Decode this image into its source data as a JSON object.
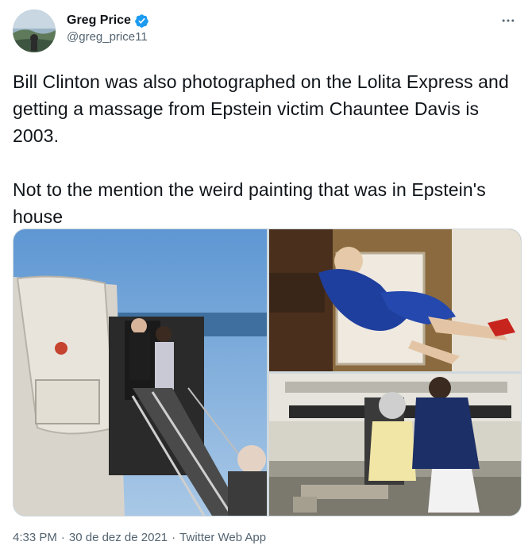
{
  "author": {
    "display_name": "Greg Price",
    "handle": "@greg_price11",
    "verified": true
  },
  "icons": {
    "avatar": "avatar",
    "verified": "verified-badge-icon",
    "more": "more-options-icon"
  },
  "tweet": {
    "text": "Bill Clinton was also photographed on the Lolita Express and getting a massage from Epstein victim Chauntee Davis is 2003.\n\nNot to the mention the weird painting that was in Epstein's house"
  },
  "meta": {
    "time": "4:33 PM",
    "separator1": "·",
    "date": "30 de dez de 2021",
    "separator2": "·",
    "source": "Twitter Web App"
  },
  "colors": {
    "text_primary": "#0f1419",
    "text_secondary": "#536471",
    "verified_blue": "#1d9bf0",
    "border": "#cfd9de"
  }
}
